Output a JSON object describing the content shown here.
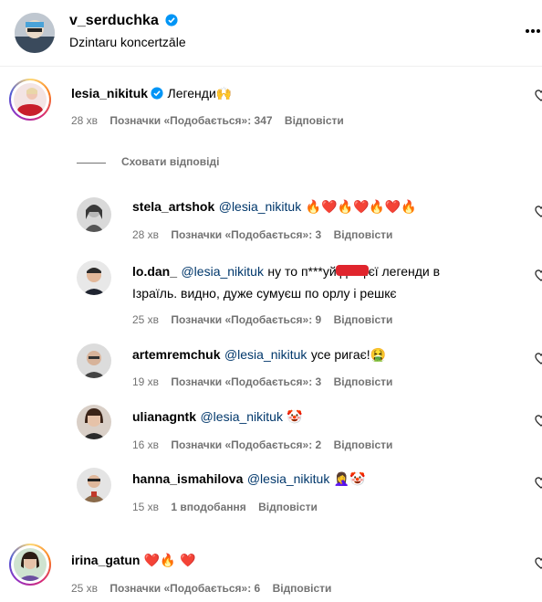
{
  "post": {
    "username": "v_serduchka",
    "location": "Dzintaru koncertzāle",
    "more_icon": "more-horizontal-icon"
  },
  "comments": [
    {
      "username": "lesia_nikituk",
      "verified": true,
      "text": "Легенди",
      "emoji": "🙌",
      "time": "28 хв",
      "likes": "Позначки «Подобається»: 347",
      "reply": "Відповісти",
      "hide_replies": "Сховати відповіді",
      "replies": [
        {
          "username": "stela_artshok",
          "mention": "@lesia_nikituk",
          "text": "🔥❤️🔥❤️🔥❤️🔥",
          "time": "28 хв",
          "likes": "Позначки «Подобається»: 3",
          "reply": "Відповісти"
        },
        {
          "username": "lo.dan_",
          "mention": "@lesia_nikituk",
          "text": "ну то п***уй до цієї легенди в",
          "text2": "Ізраїль. видно, дуже сумуєш по орлу і решкє",
          "time": "25 хв",
          "likes": "Позначки «Подобається»: 9",
          "reply": "Відповісти"
        },
        {
          "username": "artemremchuk",
          "mention": "@lesia_nikituk",
          "text": "усе ригає!",
          "emoji": "🤮",
          "time": "19 хв",
          "likes": "Позначки «Подобається»: 3",
          "reply": "Відповісти"
        },
        {
          "username": "ulianagntk",
          "mention": "@lesia_nikituk",
          "emoji": "🤡",
          "time": "16 хв",
          "likes": "Позначки «Подобається»: 2",
          "reply": "Відповісти"
        },
        {
          "username": "hanna_ismahilova",
          "mention": "@lesia_nikituk",
          "emoji": "🤦‍♀️🤡",
          "time": "15 хв",
          "likes": "1 вподобання",
          "reply": "Відповісти"
        }
      ]
    },
    {
      "username": "irina_gatun",
      "text": "❤️🔥 ❤️",
      "time": "25 хв",
      "likes": "Позначки «Подобається»: 6",
      "reply": "Відповісти"
    }
  ],
  "colors": {
    "verified": "#0095f6",
    "mention": "#00376b",
    "meta": "#737373",
    "censor": "#e0252d"
  }
}
